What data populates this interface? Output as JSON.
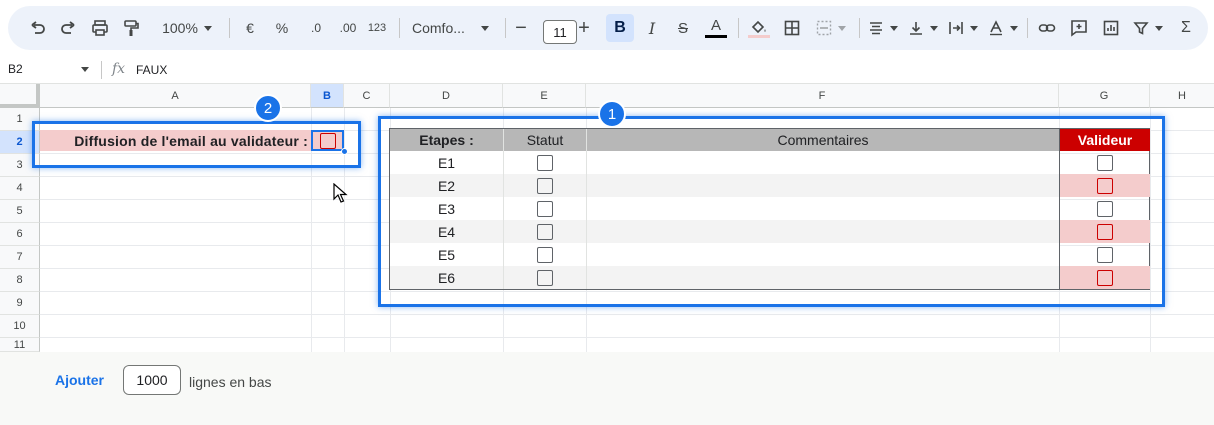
{
  "toolbar": {
    "zoom": "100%",
    "currency": "€",
    "percent": "%",
    "decrease_decimal": ".0",
    "increase_decimal": ".00",
    "number_format": "123",
    "font": "Comfo...",
    "font_size": "11",
    "bold": "B",
    "italic": "I",
    "strike": "S",
    "text_color": "A",
    "sum": "Σ"
  },
  "formula_bar": {
    "cell_ref": "B2",
    "fx": "fx",
    "value": "FAUX"
  },
  "columns": [
    "A",
    "B",
    "C",
    "D",
    "E",
    "F",
    "G",
    "H"
  ],
  "rows": [
    "1",
    "2",
    "3",
    "4",
    "5",
    "6",
    "7",
    "8",
    "9",
    "10",
    "11"
  ],
  "selected_cell": {
    "column": "B",
    "row": "2"
  },
  "diffusion_label": "Diffusion de l'email au validateur :",
  "table": {
    "headers": {
      "etapes": "Etapes :",
      "statut": "Statut",
      "commentaires": "Commentaires",
      "valideur": "Valideur"
    },
    "rows": [
      {
        "etape": "E1",
        "statut": false,
        "valideur": false
      },
      {
        "etape": "E2",
        "statut": false,
        "valideur": false
      },
      {
        "etape": "E3",
        "statut": false,
        "valideur": false
      },
      {
        "etape": "E4",
        "statut": false,
        "valideur": false
      },
      {
        "etape": "E5",
        "statut": false,
        "valideur": false
      },
      {
        "etape": "E6",
        "statut": false,
        "valideur": false
      }
    ]
  },
  "annotations": {
    "badge_table": "1",
    "badge_cell": "2"
  },
  "bottom": {
    "add_label": "Ajouter",
    "add_count": "1000",
    "add_suffix": "lignes en bas"
  },
  "colors": {
    "accent": "#1a73e8",
    "header_grey": "#b7b7b7",
    "valideur_red": "#cc0000",
    "pink_fill": "#f4cccc",
    "stripe_grey": "#f3f3f3"
  }
}
